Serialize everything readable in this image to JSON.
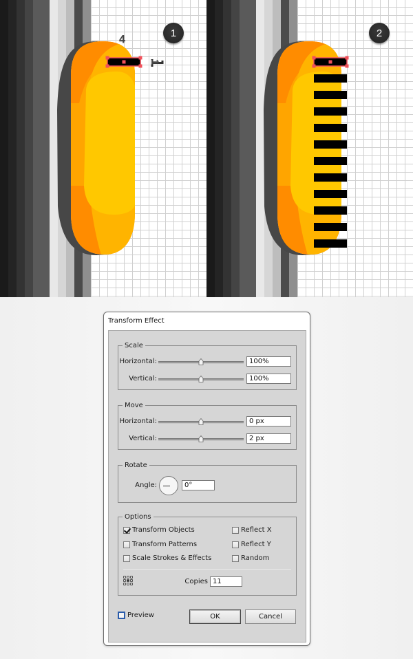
{
  "canvas": {
    "stripe_colors": [
      "#1a1a1a",
      "#242424",
      "#333333",
      "#444444",
      "#5a5a5a",
      "#5a5a5a",
      "#e8e8e8",
      "#d6d6d6",
      "#bdbdbd",
      "#4b4b4b",
      "#8f8f8f"
    ],
    "capsule_colors": {
      "shadow": "#474747",
      "dark_orange": "#ff8c00",
      "orange": "#ffa500",
      "light_orange": "#ffb400",
      "yellow": "#ffc800"
    },
    "selection_color": "#f0505a",
    "panels": [
      {
        "step_label": "1",
        "annotation_width_label": "4",
        "annotation_height_label": "1",
        "bar_count": 1
      },
      {
        "step_label": "2",
        "bar_count": 12
      }
    ]
  },
  "dialog": {
    "title": "Transform Effect",
    "scale": {
      "legend": "Scale",
      "horizontal_label": "Horizontal:",
      "horizontal_value": "100%",
      "horizontal_slider_fraction": 0.5,
      "vertical_label": "Vertical:",
      "vertical_value": "100%",
      "vertical_slider_fraction": 0.5
    },
    "move": {
      "legend": "Move",
      "horizontal_label": "Horizontal:",
      "horizontal_value": "0 px",
      "horizontal_slider_fraction": 0.5,
      "vertical_label": "Vertical:",
      "vertical_value": "2 px",
      "vertical_slider_fraction": 0.5
    },
    "rotate": {
      "legend": "Rotate",
      "angle_label": "Angle:",
      "angle_value": "0°"
    },
    "options": {
      "legend": "Options",
      "transform_objects": {
        "label": "Transform Objects",
        "checked": true
      },
      "transform_patterns": {
        "label": "Transform Patterns",
        "checked": false
      },
      "scale_strokes": {
        "label": "Scale Strokes & Effects",
        "checked": false
      },
      "reflect_x": {
        "label": "Reflect X",
        "checked": false
      },
      "reflect_y": {
        "label": "Reflect Y",
        "checked": false
      },
      "random": {
        "label": "Random",
        "checked": false
      },
      "copies_label": "Copies",
      "copies_value": "11"
    },
    "preview": {
      "label": "Preview",
      "checked": false
    },
    "ok_label": "OK",
    "cancel_label": "Cancel"
  }
}
